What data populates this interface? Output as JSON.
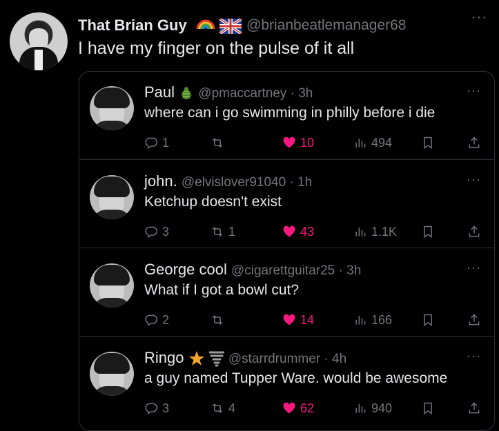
{
  "header": {
    "name": "That Brian Guy",
    "handle": "@brianbeatlemanager68",
    "text": "I have my finger on the pulse of it all",
    "more": "···"
  },
  "replies": [
    {
      "name": "Paul",
      "handle": "@pmaccartney · 3h",
      "text": "where can i go swimming in philly before i die",
      "replies": "1",
      "reposts": "",
      "likes": "10",
      "views": "494"
    },
    {
      "name": "john.",
      "handle": "@elvislover91040 · 1h",
      "text": "Ketchup doesn't exist",
      "replies": "3",
      "reposts": "1",
      "likes": "43",
      "views": "1.1K"
    },
    {
      "name": "George cool",
      "handle": "@cigarettguitar25 · 3h",
      "text": "What if I got a bowl cut?",
      "replies": "2",
      "reposts": "",
      "likes": "14",
      "views": "166"
    },
    {
      "name": "Ringo",
      "handle": "@starrdrummer · 4h",
      "text": "a guy named Tupper Ware. would be awesome",
      "replies": "3",
      "reposts": "4",
      "likes": "62",
      "views": "940"
    }
  ],
  "colors": {
    "like": "#f91880",
    "muted": "#71767b",
    "text": "#e7e9ea",
    "border": "#2f3336"
  },
  "icons": [
    "reply-icon",
    "repost-icon",
    "heart-icon",
    "views-icon",
    "bookmark-icon",
    "share-icon",
    "more-icon",
    "bug-emoji-icon",
    "star-emoji-icon",
    "tornado-emoji-icon",
    "rainbow-emoji-icon",
    "uk-flag-icon"
  ]
}
